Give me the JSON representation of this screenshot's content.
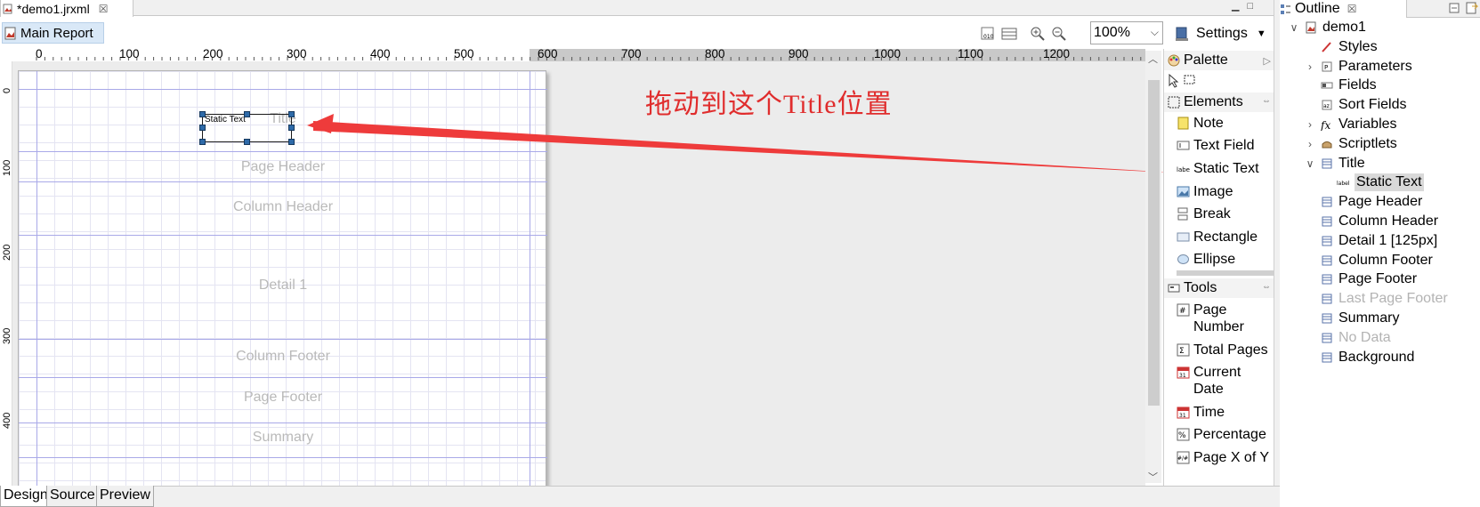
{
  "editor": {
    "tab_title": "*demo1.jrxml",
    "tab_close": "☒",
    "main_report_label": "Main Report",
    "zoom_value": "100%",
    "settings_label": "Settings"
  },
  "ruler": {
    "labels": [
      "0",
      "100",
      "200",
      "300",
      "400",
      "500",
      "600",
      "700",
      "800",
      "900",
      "1000",
      "1100",
      "1200"
    ],
    "vertical_labels": [
      "0",
      "100",
      "200",
      "300",
      "400"
    ]
  },
  "canvas": {
    "bands": [
      "Title",
      "Page Header",
      "Column Header",
      "Detail 1",
      "Column Footer",
      "Page Footer",
      "Summary"
    ],
    "selected_element_text": "Static Text",
    "annotation": "拖动到这个Title位置",
    "annotation_color": "#e02d2d"
  },
  "palette": {
    "header": "Palette",
    "elements_header": "Elements",
    "elements": [
      {
        "label": "Note",
        "icon": "note-icon"
      },
      {
        "label": "Text Field",
        "icon": "text-field-icon"
      },
      {
        "label": "Static Text",
        "icon": "static-text-icon"
      },
      {
        "label": "Image",
        "icon": "image-icon"
      },
      {
        "label": "Break",
        "icon": "break-icon"
      },
      {
        "label": "Rectangle",
        "icon": "rectangle-icon"
      },
      {
        "label": "Ellipse",
        "icon": "ellipse-icon"
      }
    ],
    "tools_header": "Tools",
    "tools": [
      {
        "label": "Page Number",
        "icon": "page-number-icon"
      },
      {
        "label": "Total Pages",
        "icon": "total-pages-icon"
      },
      {
        "label": "Current Date",
        "icon": "current-date-icon"
      },
      {
        "label": "Time",
        "icon": "time-icon"
      },
      {
        "label": "Percentage",
        "icon": "percentage-icon"
      },
      {
        "label": "Page X of Y",
        "icon": "page-x-of-y-icon"
      }
    ]
  },
  "outline": {
    "tab_title": "Outline",
    "tab_close": "☒",
    "tree": [
      {
        "label": "demo1",
        "disabled": false,
        "selected": false
      },
      {
        "label": "Styles",
        "disabled": false,
        "selected": false
      },
      {
        "label": "Parameters",
        "disabled": false,
        "selected": false
      },
      {
        "label": "Fields",
        "disabled": false,
        "selected": false
      },
      {
        "label": "Sort Fields",
        "disabled": false,
        "selected": false
      },
      {
        "label": "Variables",
        "disabled": false,
        "selected": false
      },
      {
        "label": "Scriptlets",
        "disabled": false,
        "selected": false
      },
      {
        "label": "Title",
        "disabled": false,
        "selected": false
      },
      {
        "label": "Static Text",
        "disabled": false,
        "selected": true
      },
      {
        "label": "Page Header",
        "disabled": false,
        "selected": false
      },
      {
        "label": "Column Header",
        "disabled": false,
        "selected": false
      },
      {
        "label": "Detail 1 [125px]",
        "disabled": false,
        "selected": false
      },
      {
        "label": "Column Footer",
        "disabled": false,
        "selected": false
      },
      {
        "label": "Page Footer",
        "disabled": false,
        "selected": false
      },
      {
        "label": "Last Page Footer",
        "disabled": true,
        "selected": false
      },
      {
        "label": "Summary",
        "disabled": false,
        "selected": false
      },
      {
        "label": "No Data",
        "disabled": true,
        "selected": false
      },
      {
        "label": "Background",
        "disabled": false,
        "selected": false
      }
    ]
  },
  "bottom_tabs": [
    "Design",
    "Source",
    "Preview"
  ]
}
